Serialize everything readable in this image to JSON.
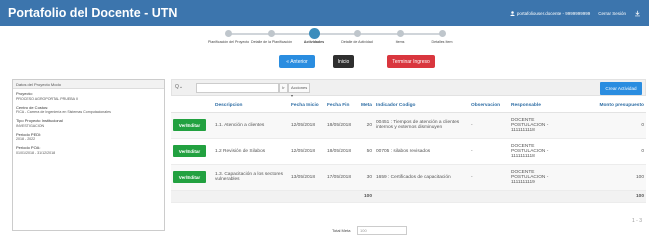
{
  "header": {
    "title": "Portafolio del Docente - UTN",
    "user": "portafoliouser.docente - 9999999999",
    "menu1": "Cerrar Sesión",
    "menu2": "⇩"
  },
  "wizard": {
    "steps": [
      {
        "label": "Planificación del Proyecto",
        "active": false
      },
      {
        "label": "Detalle de la Planificación",
        "active": false
      },
      {
        "label": "Actividades",
        "active": true
      },
      {
        "label": "Detalle de Actividad",
        "active": false
      },
      {
        "label": "Items",
        "active": false
      },
      {
        "label": "Detalles Item",
        "active": false
      }
    ]
  },
  "nav": {
    "prev": "« Anterior",
    "home": "Inicio",
    "end": "Terminar Ingreso"
  },
  "side": {
    "heading": "Datos del Proyecto Modo",
    "fields": [
      {
        "label": "Proyecto:",
        "value": "PROCESO AGROPORTAL PRUEBA II"
      },
      {
        "label": "Centro de Costos:",
        "value": "FICA - Carrera de Ingeniería en Sistemas Computacionales"
      },
      {
        "label": "Tipo Proyecto Institucional",
        "value": "INVESTIGACION"
      },
      {
        "label": "Periodo PEDI:",
        "value": "2018 - 2022"
      },
      {
        "label": "Periodo POA:",
        "value": "01/01/2018 - 31/12/2018"
      }
    ]
  },
  "toolbar": {
    "search_placeholder": "",
    "search_btn": "Ir",
    "actions": "Acciones ▾",
    "create": "Crear Actividad"
  },
  "table": {
    "columns": [
      "",
      "Descripcion",
      "Fecha Inicio",
      "Fecha Fin",
      "Meta",
      "Indicador Codigo",
      "Observacion",
      "Responsable",
      "Monto presupuesto"
    ],
    "edit_label": "Ver/Editar",
    "rows": [
      {
        "descripcion": "1.1. Atención a clientes",
        "inicio": "12/05/2018",
        "fin": "18/05/2018",
        "meta": "20",
        "indicador": "00451 : Tiempos de atención a clientes internos y externos disminuyen",
        "observacion": "-",
        "responsable": "DOCENTE POSTULACION - 1111111118",
        "monto": "0"
      },
      {
        "descripcion": "1.2 Revisión de Silabos",
        "inicio": "12/05/2018",
        "fin": "18/05/2018",
        "meta": "50",
        "indicador": "00705 : silabos revisados",
        "observacion": "-",
        "responsable": "DOCENTE POSTULACION - 1111111118",
        "monto": "0"
      },
      {
        "descripcion": "1.3. Capacitación a los sectores vulnerables",
        "inicio": "13/05/2018",
        "fin": "17/05/2018",
        "meta": "30",
        "indicador": "1659 : Certificados de capacitación",
        "observacion": "-",
        "responsable": "DOCENTE POSTULACION - 1111111119",
        "monto": "100"
      }
    ],
    "total_meta": "100",
    "total_monto": "100"
  },
  "pager": "1 - 3",
  "footer": {
    "label": "Total Meta",
    "value": "100"
  }
}
